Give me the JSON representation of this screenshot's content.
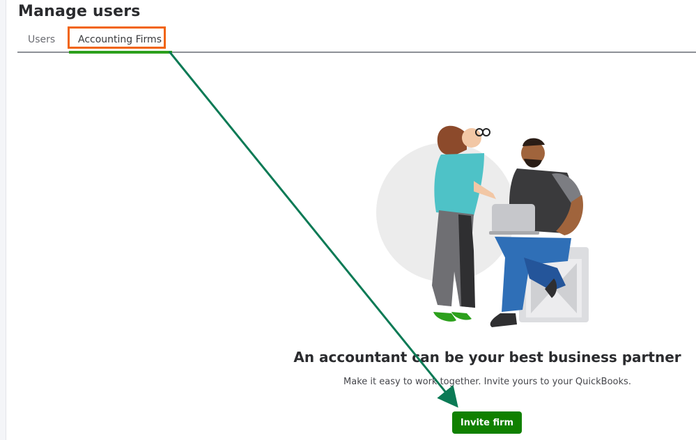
{
  "page": {
    "title": "Manage users"
  },
  "tabs": [
    {
      "label": "Users",
      "selected": false
    },
    {
      "label": "Accounting Firms",
      "selected": true
    }
  ],
  "empty_state": {
    "headline": "An accountant can be your best business partner",
    "subtext": "Make it easy to work together. Invite yours to your QuickBooks.",
    "button_label": "Invite firm"
  },
  "colors": {
    "accent_green": "#108000",
    "tab_underline": "#2ca01c",
    "highlight_orange": "#f1640e",
    "annotation_arrow": "#0b7a55"
  },
  "icons": {
    "illustration": "accountant-collaboration-illustration",
    "annotation": "annotation-arrow"
  }
}
